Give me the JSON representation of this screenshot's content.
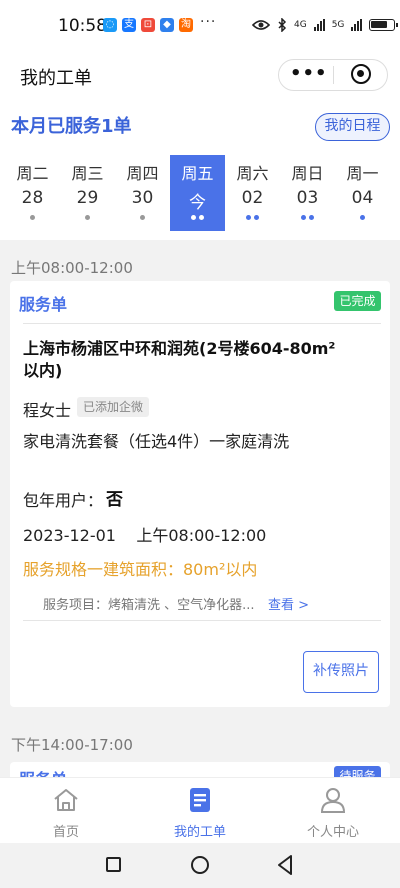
{
  "status_bar": {
    "time": "10:58",
    "apps": [
      {
        "icon": "chat-bubble-icon",
        "color": "#1a9af7",
        "glyph": "◌"
      },
      {
        "icon": "alipay-icon",
        "color": "#1677ff",
        "glyph": "支"
      },
      {
        "icon": "app-red-icon",
        "color": "#ef4a3a",
        "glyph": "⊡"
      },
      {
        "icon": "shield-icon",
        "color": "#2f80ed",
        "glyph": "◆"
      },
      {
        "icon": "taobao-icon",
        "color": "#ff6a00",
        "glyph": "淘"
      }
    ],
    "more": "···",
    "network_4g": "4G",
    "network_5g": "5G"
  },
  "header": {
    "title": "我的工单",
    "more_label": "•••"
  },
  "summary": {
    "month_text": "本月已服务1单",
    "schedule_button": "我的日程"
  },
  "week": [
    {
      "name": "周二",
      "num": "28",
      "dots": 1,
      "dot_color": "#999999",
      "selected": false
    },
    {
      "name": "周三",
      "num": "29",
      "dots": 1,
      "dot_color": "#999999",
      "selected": false
    },
    {
      "name": "周四",
      "num": "30",
      "dots": 1,
      "dot_color": "#999999",
      "selected": false
    },
    {
      "name": "周五",
      "num": "今",
      "dots": 2,
      "dot_color": "#ffffff",
      "selected": true
    },
    {
      "name": "周六",
      "num": "02",
      "dots": 2,
      "dot_color": "#4a72e8",
      "selected": false
    },
    {
      "name": "周日",
      "num": "03",
      "dots": 2,
      "dot_color": "#4a72e8",
      "selected": false
    },
    {
      "name": "周一",
      "num": "04",
      "dots": 1,
      "dot_color": "#4a72e8",
      "selected": false
    }
  ],
  "slot1": {
    "time_range": "上午08:00-12:00",
    "card": {
      "title": "服务单",
      "status": "已完成",
      "address": "上海市杨浦区中环和润苑(2号楼604-80m²以内)",
      "customer": "程女士",
      "tag": "已添加企微",
      "package": "家电清洗套餐（任选4件）一家庭清洗",
      "yearly_label": "包年用户：",
      "yearly_value": "否",
      "datetime": "2023-12-01    上午08:00-12:00",
      "spec": "服务规格一建筑面积：80m²以内",
      "items": "服务项目：烤箱清洗 、空气净化器...",
      "view_link": "查看 >",
      "photo_button": "补传照片"
    }
  },
  "slot2": {
    "time_range": "下午14:00-17:00",
    "card": {
      "title": "服务单",
      "status": "待服务"
    }
  },
  "tabs": [
    {
      "label": "首页",
      "icon": "home-icon",
      "active": false
    },
    {
      "label": "我的工单",
      "icon": "work-order-icon",
      "active": true
    },
    {
      "label": "个人中心",
      "icon": "user-icon",
      "active": false
    }
  ],
  "colors": {
    "accent": "#4a72e8",
    "done": "#34c46d",
    "spec": "#e6a22c"
  }
}
